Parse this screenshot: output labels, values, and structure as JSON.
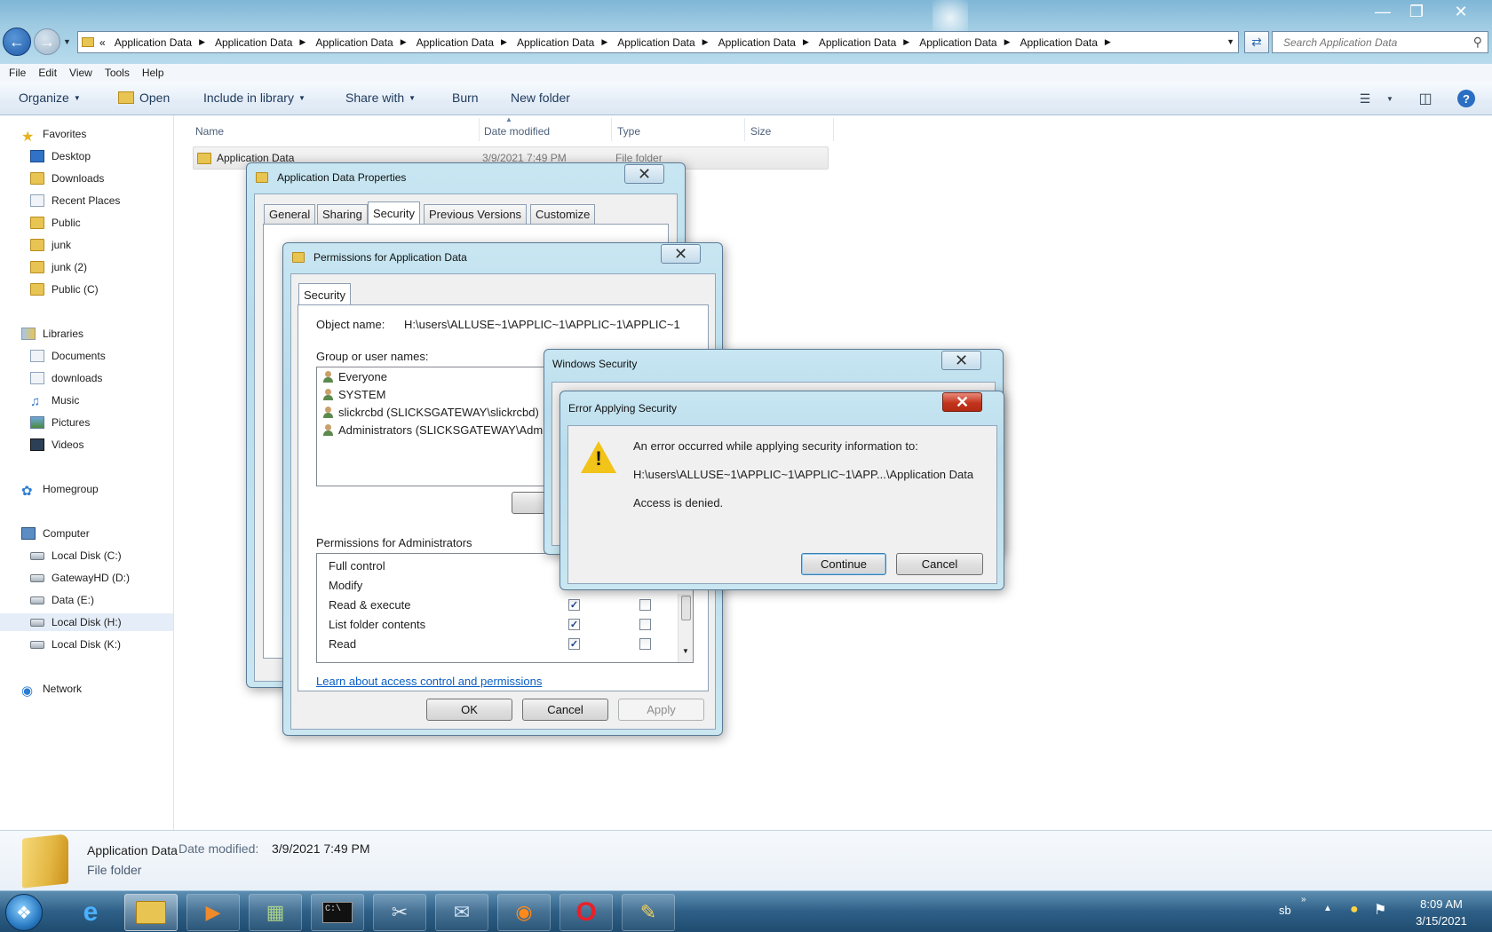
{
  "explorer": {
    "breadcrumbs": [
      "Application Data",
      "Application Data",
      "Application Data",
      "Application Data",
      "Application Data",
      "Application Data",
      "Application Data",
      "Application Data",
      "Application Data",
      "Application Data"
    ],
    "search_placeholder": "Search Application Data",
    "menu": [
      "File",
      "Edit",
      "View",
      "Tools",
      "Help"
    ],
    "toolbar": {
      "organize": "Organize",
      "open": "Open",
      "include": "Include in library",
      "share": "Share with",
      "burn": "Burn",
      "new_folder": "New folder"
    },
    "columns": {
      "name": "Name",
      "date": "Date modified",
      "type": "Type",
      "size": "Size"
    },
    "file": {
      "name": "Application Data",
      "date": "3/9/2021 7:49 PM",
      "type": "File folder"
    }
  },
  "nav": {
    "favorites": "Favorites",
    "fav_items": [
      "Desktop",
      "Downloads",
      "Recent Places",
      "Public",
      "junk",
      "junk (2)",
      "Public (C)"
    ],
    "libraries": "Libraries",
    "lib_items": [
      "Documents",
      "downloads",
      "Music",
      "Pictures",
      "Videos"
    ],
    "homegroup": "Homegroup",
    "computer": "Computer",
    "drives": [
      "Local Disk (C:)",
      "GatewayHD (D:)",
      "Data (E:)",
      "Local Disk (H:)",
      "Local Disk (K:)"
    ],
    "network": "Network"
  },
  "details": {
    "name": "Application Data",
    "date_label": "Date modified:",
    "date_value": "3/9/2021 7:49 PM",
    "type": "File folder"
  },
  "properties": {
    "title": "Application Data Properties",
    "tabs": [
      "General",
      "Sharing",
      "Security",
      "Previous Versions",
      "Customize"
    ]
  },
  "permissions": {
    "title": "Permissions for Application Data",
    "tab": "Security",
    "object_label": "Object name:",
    "object_value": "H:\\users\\ALLUSE~1\\APPLIC~1\\APPLIC~1\\APPLIC~1",
    "group_label": "Group or user names:",
    "users": [
      "Everyone",
      "SYSTEM",
      "slickrcbd (SLICKSGATEWAY\\slickrcbd)",
      "Administrators (SLICKSGATEWAY\\Adm"
    ],
    "perm_label": "Permissions for Administrators",
    "perms": [
      "Full control",
      "Modify",
      "Read & execute",
      "List folder contents",
      "Read"
    ],
    "learn_link": "Learn about access control and permissions",
    "ok": "OK",
    "cancel": "Cancel",
    "apply": "Apply"
  },
  "winsec": {
    "title": "Windows Security"
  },
  "error": {
    "title": "Error Applying Security",
    "line1": "An error occurred while applying security information to:",
    "line2": "H:\\users\\ALLUSE~1\\APPLIC~1\\APPLIC~1\\APP...\\Application Data",
    "line3": "Access is denied.",
    "continue": "Continue",
    "cancel": "Cancel"
  },
  "taskbar": {
    "tray_text": "sb",
    "time": "8:09 AM",
    "date": "3/15/2021"
  }
}
